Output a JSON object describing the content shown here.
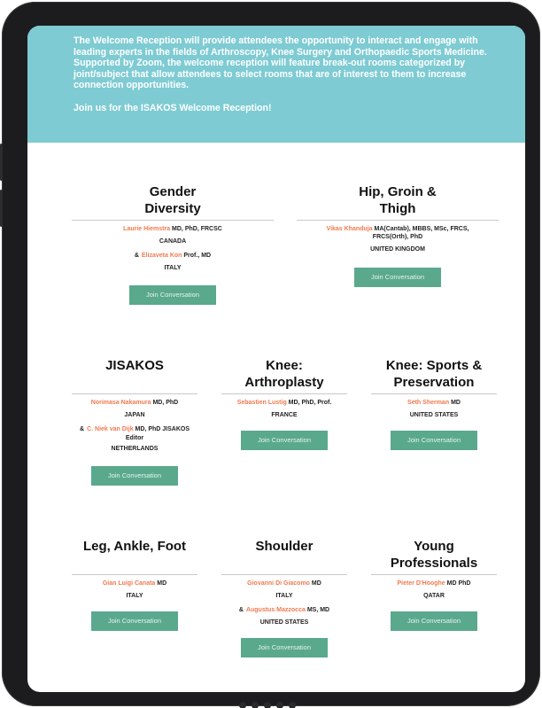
{
  "banner": {
    "intro": "The Welcome Reception will provide attendees the opportunity to interact and engage with leading experts in the fields of Arthroscopy, Knee Surgery and Orthopaedic Sports Medicine. Supported by Zoom, the welcome reception will feature break-out rooms categorized by joint/subject that allow attendees to select rooms that are of interest to them to increase connection opportunities.",
    "join": "Join us for the ISAKOS Welcome Reception!"
  },
  "button_label": "Join Conversation",
  "rooms": [
    {
      "title": "Gender Diversity",
      "lines": [
        {
          "name": "Laurie Hiemstra",
          "cred": "MD, PhD, FRCSC"
        },
        {
          "country": "CANADA"
        },
        {
          "amp": "&",
          "name": "Elizaveta Kon",
          "cred": "Prof., MD"
        },
        {
          "country": "ITALY"
        }
      ]
    },
    {
      "title": "Hip, Groin & Thigh",
      "lines": [
        {
          "name": "Vikas Khanduja",
          "cred": "MA(Cantab), MBBS, MSc, FRCS, FRCS(Orth), PhD"
        },
        {
          "country": "UNITED KINGDOM"
        }
      ]
    },
    {
      "title": "JISAKOS",
      "lines": [
        {
          "name": "Norimasa Nakamura",
          "cred": "MD, PhD"
        },
        {
          "country": "JAPAN"
        },
        {
          "amp": "&",
          "name": "C. Niek van Dijk",
          "cred": "MD, PhD JISAKOS"
        },
        {
          "note": "Editor"
        },
        {
          "country": "NETHERLANDS"
        }
      ]
    },
    {
      "title": "Knee: Arthroplasty",
      "lines": [
        {
          "name": "Sebastien Lustig",
          "cred": "MD, PhD, Prof."
        },
        {
          "country": "FRANCE"
        }
      ]
    },
    {
      "title": "Knee: Sports & Preservation",
      "lines": [
        {
          "name": "Seth Sherman",
          "cred": "MD"
        },
        {
          "country": "UNITED STATES"
        }
      ]
    },
    {
      "title": "Leg, Ankle, Foot",
      "lines": [
        {
          "name": "Gian Luigi Canata",
          "cred": "MD"
        },
        {
          "country": "ITALY"
        }
      ]
    },
    {
      "title": "Shoulder",
      "lines": [
        {
          "name": "Giovanni Di Giacomo",
          "cred": "MD"
        },
        {
          "country": "ITALY"
        },
        {
          "amp": "&",
          "name": "Augustus Mazzocca",
          "cred": "MS, MD"
        },
        {
          "country": "UNITED STATES"
        }
      ]
    },
    {
      "title": "Young Professionals",
      "lines": [
        {
          "name": "Pieter D'Hooghe",
          "cred": "MD PhD"
        },
        {
          "country": "QATAR"
        }
      ]
    }
  ]
}
